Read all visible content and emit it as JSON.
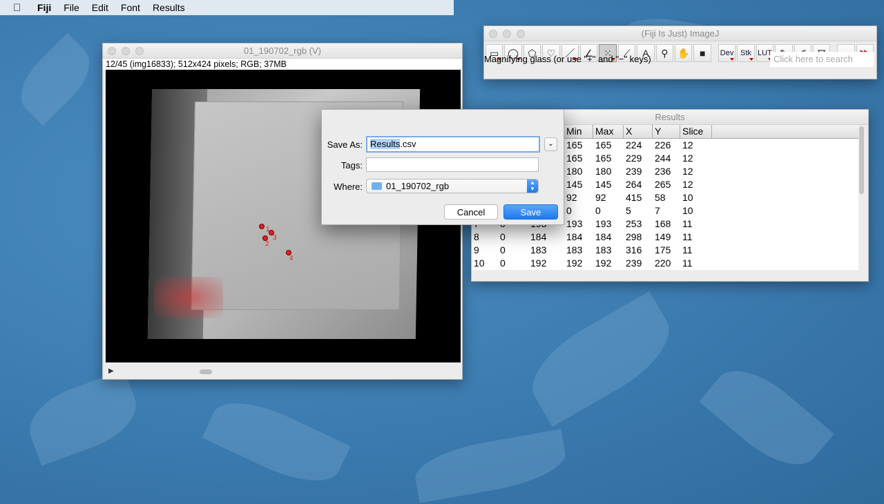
{
  "menubar": {
    "items": [
      "Fiji",
      "File",
      "Edit",
      "Font",
      "Results"
    ]
  },
  "image_window": {
    "title": "01_190702_rgb (V)",
    "info": "12/45 (img16833); 512x424 pixels; RGB; 37MB",
    "markers": [
      "1",
      "2",
      "3",
      "4"
    ]
  },
  "imagej": {
    "title": "(Fiji Is Just) ImageJ",
    "tools": [
      {
        "icon": "rectangle-tool-icon",
        "glyph": "▭"
      },
      {
        "icon": "oval-tool-icon",
        "glyph": "◯"
      },
      {
        "icon": "polygon-tool-icon",
        "glyph": "⬠"
      },
      {
        "icon": "freehand-tool-icon",
        "glyph": "♡"
      },
      {
        "icon": "line-tool-icon",
        "glyph": "／"
      },
      {
        "icon": "angle-tool-icon",
        "glyph": "∠"
      },
      {
        "icon": "multipoint-tool-icon",
        "glyph": "⁙"
      },
      {
        "icon": "wand-tool-icon",
        "glyph": "⟋"
      },
      {
        "icon": "text-tool-icon",
        "glyph": "A"
      },
      {
        "icon": "magnifier-tool-icon",
        "glyph": "⚲"
      },
      {
        "icon": "hand-tool-icon",
        "glyph": "✋"
      },
      {
        "icon": "color-picker-tool-icon",
        "glyph": "■"
      },
      {
        "icon": "dev-menu-icon",
        "glyph": "Dev"
      },
      {
        "icon": "stk-menu-icon",
        "glyph": "Stk"
      },
      {
        "icon": "lut-menu-icon",
        "glyph": "LUT"
      },
      {
        "icon": "pencil-tool-icon",
        "glyph": "✎"
      },
      {
        "icon": "brush-tool-icon",
        "glyph": "✐"
      },
      {
        "icon": "flood-fill-tool-icon",
        "glyph": "⛛"
      },
      {
        "icon": "blank-tool-icon",
        "glyph": ""
      },
      {
        "icon": "more-tools-icon",
        "glyph": "≫"
      }
    ],
    "status": "Magnifying glass (or use \"+\" and \"−\" keys)",
    "search_placeholder": "Click here to search"
  },
  "results": {
    "title": "Results",
    "columns": [
      "Min",
      "Max",
      "X",
      "Y",
      "Slice"
    ],
    "rows": [
      {
        "idx": "",
        "c1": "",
        "c2": "",
        "min": "165",
        "max": "165",
        "x": "224",
        "y": "226",
        "slice": "12"
      },
      {
        "idx": "",
        "c1": "",
        "c2": "",
        "min": "165",
        "max": "165",
        "x": "229",
        "y": "244",
        "slice": "12"
      },
      {
        "idx": "",
        "c1": "",
        "c2": "",
        "min": "180",
        "max": "180",
        "x": "239",
        "y": "236",
        "slice": "12"
      },
      {
        "idx": "",
        "c1": "",
        "c2": "",
        "min": "145",
        "max": "145",
        "x": "264",
        "y": "265",
        "slice": "12"
      },
      {
        "idx": "",
        "c1": "",
        "c2": "",
        "min": "92",
        "max": "92",
        "x": "415",
        "y": "58",
        "slice": "10"
      },
      {
        "idx": "",
        "c1": "",
        "c2": "",
        "min": "0",
        "max": "0",
        "x": "5",
        "y": "7",
        "slice": "10"
      },
      {
        "idx": "7",
        "c1": "0",
        "c2": "193",
        "min": "193",
        "max": "193",
        "x": "253",
        "y": "168",
        "slice": "11"
      },
      {
        "idx": "8",
        "c1": "0",
        "c2": "184",
        "min": "184",
        "max": "184",
        "x": "298",
        "y": "149",
        "slice": "11"
      },
      {
        "idx": "9",
        "c1": "0",
        "c2": "183",
        "min": "183",
        "max": "183",
        "x": "316",
        "y": "175",
        "slice": "11"
      },
      {
        "idx": "10",
        "c1": "0",
        "c2": "192",
        "min": "192",
        "max": "192",
        "x": "239",
        "y": "220",
        "slice": "11"
      }
    ]
  },
  "save_dialog": {
    "save_as_label": "Save As:",
    "filename_selected": "Results",
    "filename_rest": ".csv",
    "tags_label": "Tags:",
    "tags_value": "",
    "where_label": "Where:",
    "where_value": "01_190702_rgb",
    "cancel": "Cancel",
    "save": "Save"
  }
}
